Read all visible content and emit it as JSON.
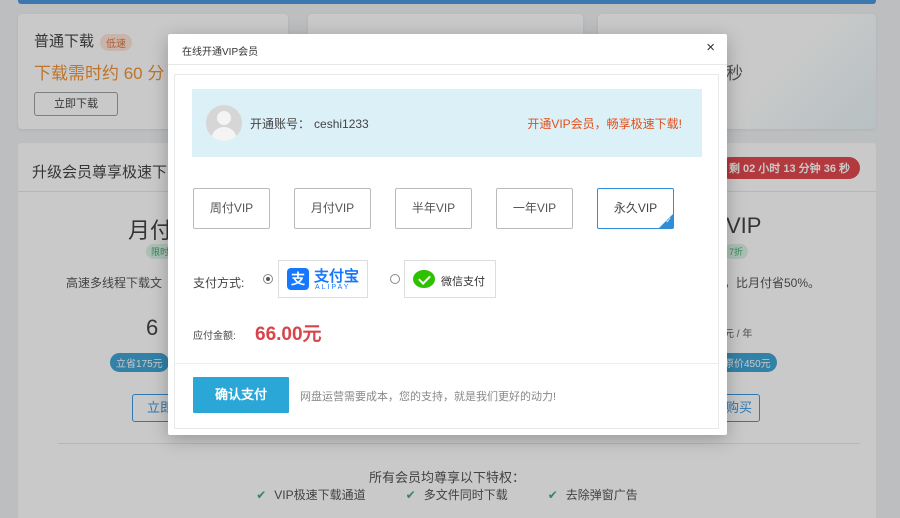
{
  "background": {
    "normal_download": {
      "title": "普通下载",
      "badge": "低速",
      "time": "下载需时约 60 分",
      "button": "立即下载"
    },
    "vip_download": {
      "seconds_hint": "秒"
    },
    "upgrade": {
      "heading": "升级会员尊享极速下",
      "countdown": "剩 02 小时 13 分钟 36 秒",
      "left_plan": {
        "name": "月付",
        "desc": "高速多线程下载文",
        "price": "6",
        "save": "立省175元",
        "buy": "立即"
      },
      "right_plan": {
        "name": "VIP",
        "tag": "7折",
        "desc": "，比月付省50%。",
        "price": "元 / 年",
        "save": "原价450元",
        "buy": "购买"
      },
      "privileges_title": "所有会员均尊享以下特权：",
      "privileges": [
        "VIP极速下载通道",
        "多文件同时下载",
        "去除弹窗广告"
      ]
    }
  },
  "modal": {
    "title": "在线开通VIP会员",
    "close": "×",
    "account_label": "开通账号：",
    "account_name": "ceshi1233",
    "promo": "开通VIP会员，畅享极速下载!",
    "plans": [
      "周付VIP",
      "月付VIP",
      "半年VIP",
      "一年VIP",
      "永久VIP"
    ],
    "selected_plan": "永久VIP",
    "payment_label": "支付方式:",
    "alipay_name": "支付宝",
    "alipay_sub": "ALIPAY",
    "wechat_name": "微信支付",
    "amount_label": "应付金额:",
    "amount_value": "66.00元",
    "confirm_button": "确认支付",
    "confirm_note": "网盘运营需要成本，您的支持，就是我们更好的动力!"
  },
  "colors": {
    "accent": "#2aa7d7",
    "price": "#d9434a",
    "promo": "#e2501c"
  }
}
